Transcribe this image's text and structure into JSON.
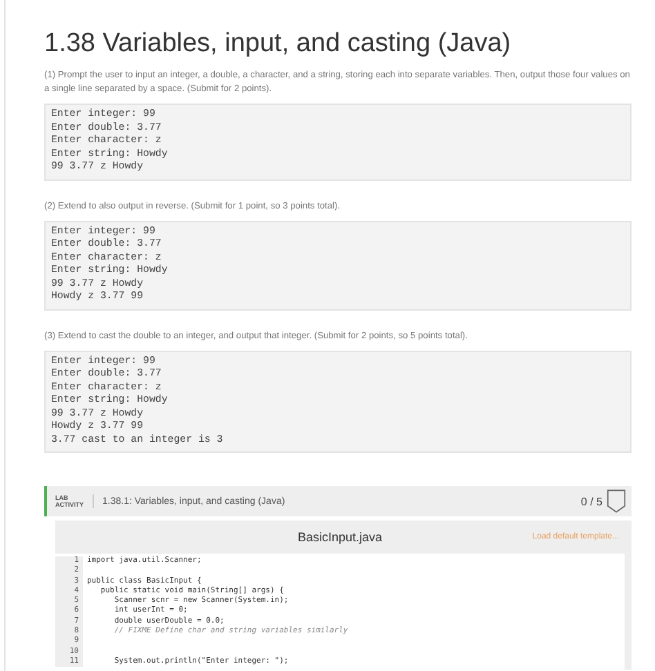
{
  "title": "1.38 Variables, input, and casting (Java)",
  "steps": [
    {
      "instructions": "(1) Prompt the user to input an integer, a double, a character, and a string, storing each into separate variables. Then, output those four values on a single line separated by a space. (Submit for 2 points).",
      "output": [
        "Enter integer: 99",
        "Enter double: 3.77",
        "Enter character: z",
        "Enter string: Howdy",
        "99 3.77 z Howdy"
      ]
    },
    {
      "instructions": "(2) Extend to also output in reverse. (Submit for 1 point, so 3 points total).",
      "output": [
        "Enter integer: 99",
        "Enter double: 3.77",
        "Enter character: z",
        "Enter string: Howdy",
        "99 3.77 z Howdy",
        "Howdy z 3.77 99"
      ]
    },
    {
      "instructions": "(3) Extend to cast the double to an integer, and output that integer. (Submit for 2 points, so 5 points total).",
      "output": [
        "Enter integer: 99",
        "Enter double: 3.77",
        "Enter character: z",
        "Enter string: Howdy",
        "99 3.77 z Howdy",
        "Howdy z 3.77 99",
        "3.77 cast to an integer is 3"
      ]
    }
  ],
  "lab": {
    "tag": "LAB ACTIVITY",
    "title": "1.38.1: Variables, input, and casting (Java)",
    "score": "0 / 5"
  },
  "editor": {
    "filename": "BasicInput.java",
    "action": "Load default template...",
    "lines": [
      {
        "number": "1",
        "code": "import java.util.Scanner;",
        "kind": "code"
      },
      {
        "number": "2",
        "kind": "code"
      },
      {
        "number": "3",
        "code": "public class BasicInput {",
        "kind": "code"
      },
      {
        "number": "4",
        "code": "   public static void main(String[] args) {",
        "kind": "code"
      },
      {
        "number": "5",
        "code": "      Scanner scnr = new Scanner(System.in);",
        "kind": "code"
      },
      {
        "number": "6",
        "code": "      int userInt = 0;",
        "kind": "code"
      },
      {
        "number": "7",
        "code": "      double userDouble = 0.0;",
        "kind": "code"
      },
      {
        "number": "8",
        "code": "      // FIXME Define char and string variables similarly",
        "kind": "comment"
      },
      {
        "number": "9",
        "kind": "code"
      },
      {
        "number": "10",
        "kind": "code"
      },
      {
        "number": "11",
        "code": "      System.out.println(\"Enter integer: \");",
        "kind": "code"
      }
    ]
  }
}
